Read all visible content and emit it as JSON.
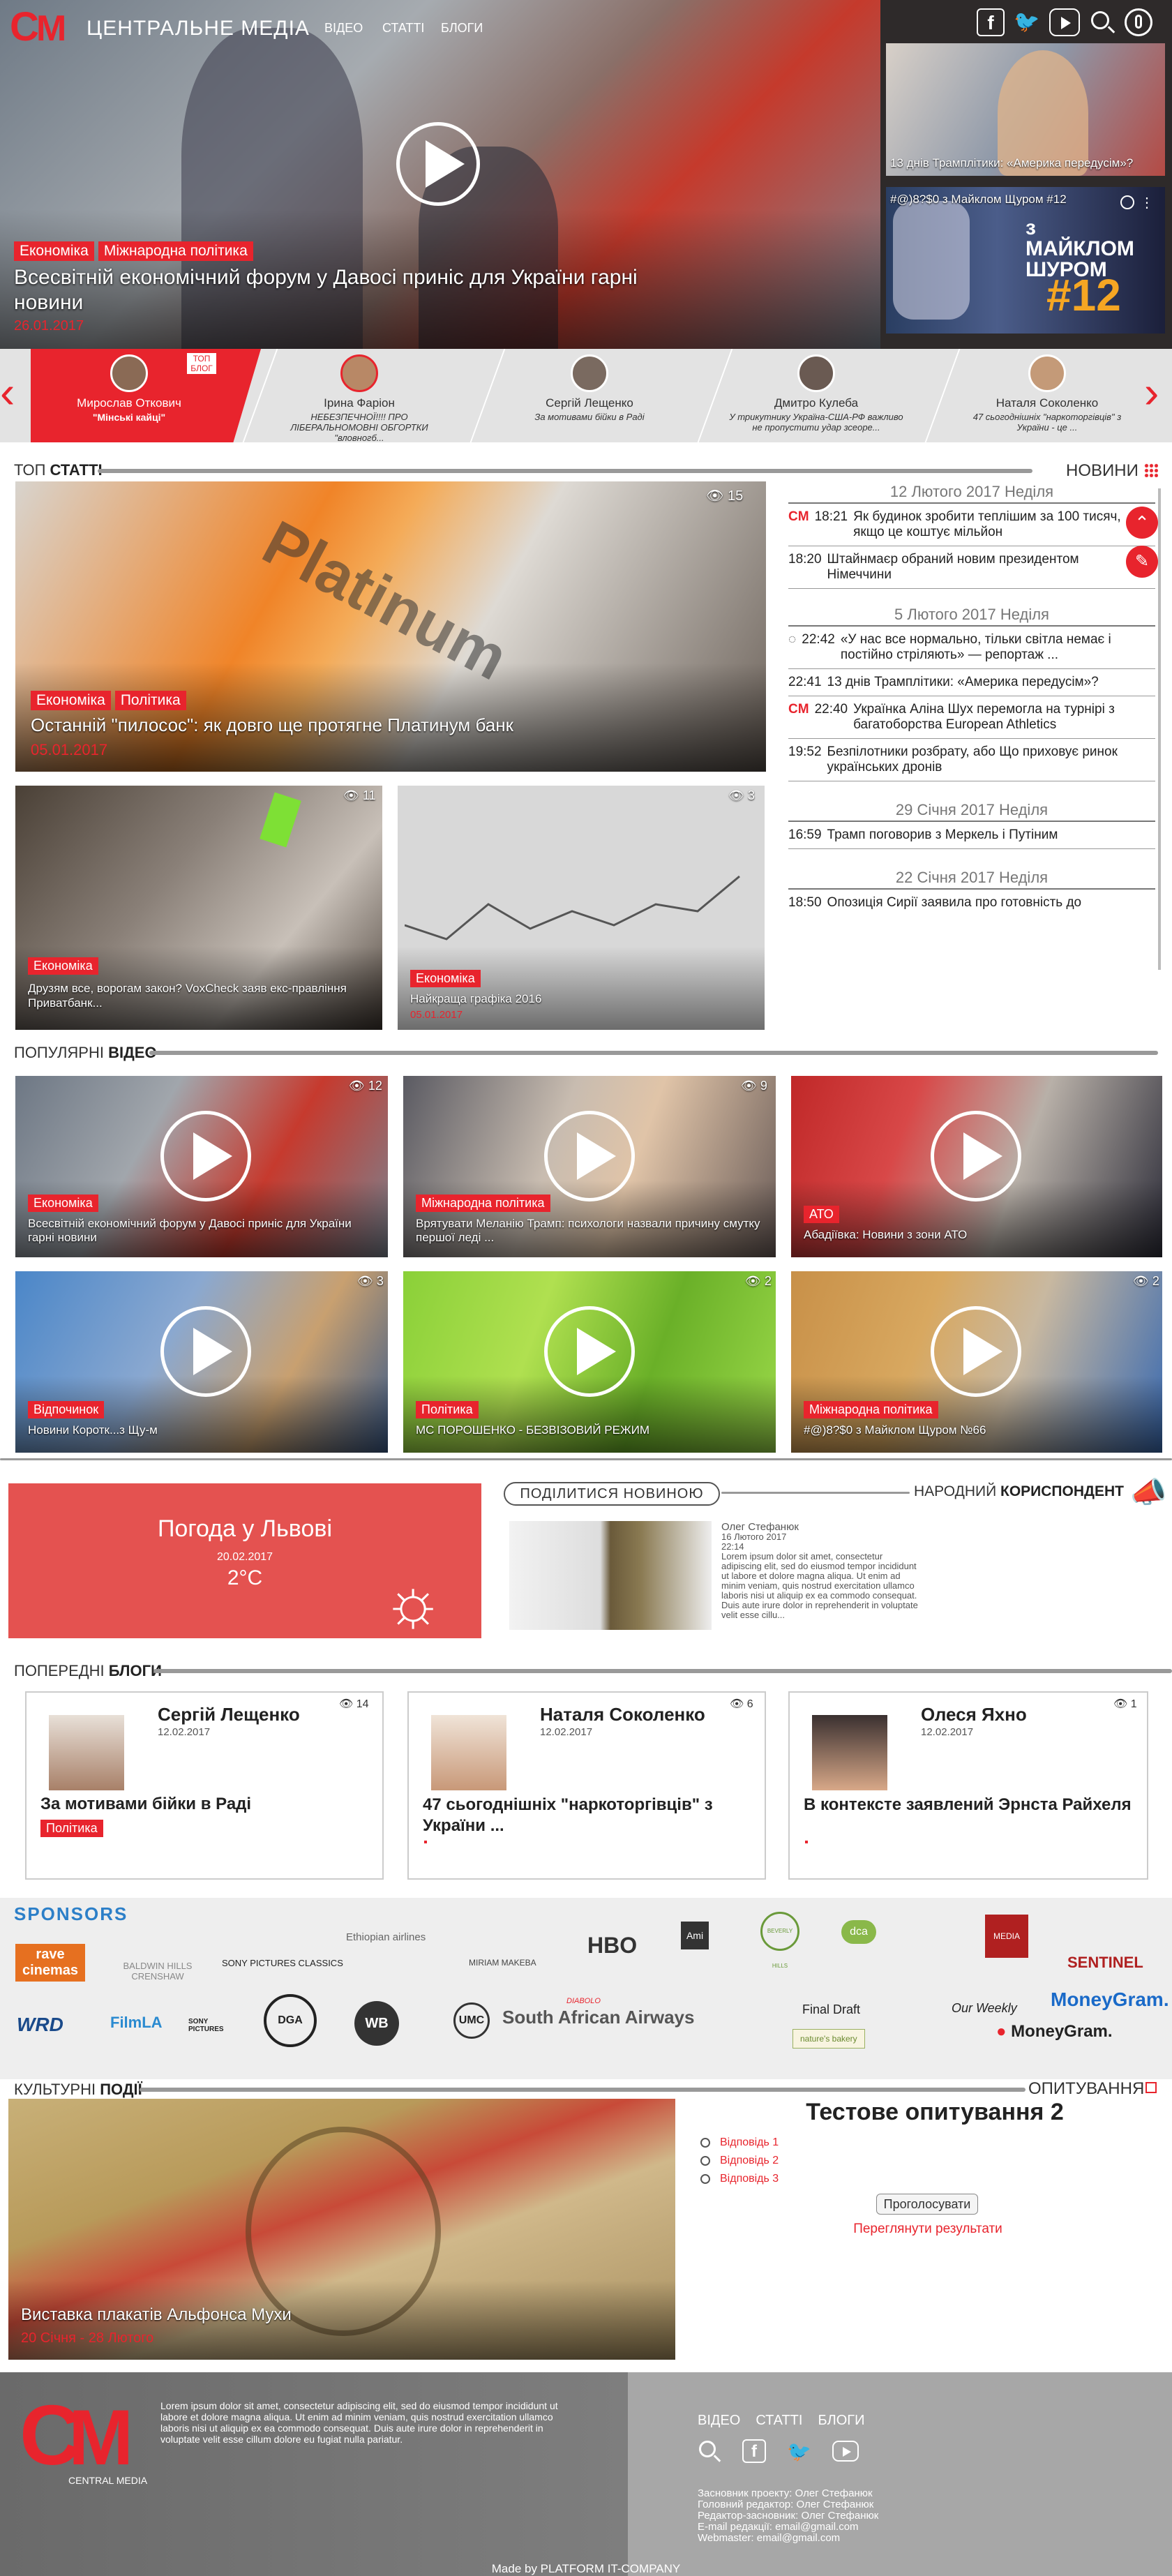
{
  "header": {
    "logo": "CM",
    "title": "ЦЕНТРАЛЬНЕ МЕДІА",
    "nav": [
      "ВІДЕО",
      "СТАТТІ",
      "БЛОГИ"
    ]
  },
  "hero": {
    "tags": [
      "Економіка",
      "Міжнародна політика"
    ],
    "title": "Всесвітній економічний форум у Давосі приніс для України гарні новини",
    "date": "26.01.2017"
  },
  "side_videos": [
    {
      "caption": "13 днів Трамплітики: «Америка передусім»?"
    },
    {
      "caption": "#@)8?$0 з Майклом Щуром #12",
      "overlay": "з МАЙКЛОМ ШУРОМ",
      "num": "#12"
    }
  ],
  "bloggers": [
    {
      "name": "Мирослав Откович",
      "title": "\"Мінські кайці\"",
      "badge": "ТОП БЛОГ"
    },
    {
      "name": "Ірина Фаріон",
      "title": "НЕБЕЗПЕЧНОЇ!!!! ПРО ЛІБЕРАЛЬНОМОВНІ ОБГОРТКИ \"вловногб..."
    },
    {
      "name": "Сергій Лещенко",
      "title": "За мотивами бійки в Раді"
    },
    {
      "name": "Дмитро Кулеба",
      "title": "У трикутнику Україна-США-РФ важливо не пропустити удар зсеоре..."
    },
    {
      "name": "Наталя Соколенко",
      "title": "47 сьогоднішніх \"наркоторгівців\" з України - це ..."
    }
  ],
  "top": {
    "head_pre": "ТОП",
    "head_bold": "СТАТТІ",
    "main": {
      "tags": [
        "Економіка",
        "Політика"
      ],
      "title": "Останній \"пилосос\": як довго ще протягне Платинум банк",
      "date": "05.01.2017",
      "views": "15"
    },
    "a2": {
      "tag": "Економіка",
      "title": "Друзям все, ворогам закон? VoxCheck заяв екс-правління Приватбанк...",
      "views": "11"
    },
    "a3": {
      "tag": "Економіка",
      "title": "Найкраща графіка 2016",
      "date": "05.01.2017",
      "views": "3"
    }
  },
  "news": {
    "head": "НОВИНИ",
    "groups": [
      {
        "date": "12 Лютого 2017 Неділя",
        "items": [
          {
            "time": "18:21",
            "text": "Як будинок зробити теплішим за 100 тисяч, якщо це коштує мільйон",
            "icon": "cm"
          },
          {
            "time": "18:20",
            "text": "Штайнмаєр обраний новим президентом Німеччини"
          }
        ]
      },
      {
        "date": "5 Лютого 2017 Неділя",
        "items": [
          {
            "time": "22:42",
            "text": "«У нас все нормально, тільки світла немає і постійно стріляють» — репортаж ...",
            "icon": "load"
          },
          {
            "time": "22:41",
            "text": "13 днів Трамплітики: «Америка передусім»?"
          },
          {
            "time": "22:40",
            "text": "Українка Аліна Шух перемогла на турнірі з багатоборства European Athletics",
            "icon": "cm"
          },
          {
            "time": "19:52",
            "text": "Безпілотники розбрату, або Що приховує ринок українських дронів"
          }
        ]
      },
      {
        "date": "29 Січня 2017 Неділя",
        "items": [
          {
            "time": "16:59",
            "text": "Трамп поговорив з Меркель і Путіним"
          }
        ]
      },
      {
        "date": "22 Січня 2017 Неділя",
        "items": [
          {
            "time": "18:50",
            "text": "Опозиція Сирії заявила про готовність до"
          }
        ]
      }
    ]
  },
  "popular": {
    "head_pre": "ПОПУЛЯРНІ",
    "head_bold": "ВІДЕО",
    "items": [
      {
        "tag": "Економіка",
        "title": "Всесвітній економічний форум у Давосі приніс для України гарні новини",
        "views": "12"
      },
      {
        "tag": "Міжнародна політика",
        "title": "Врятувати Меланію Трамп: психологи назвали причину смутку першої леді ...",
        "views": "9"
      },
      {
        "tag": "АТО",
        "title": "Абадіївка: Новини з зони АТО",
        "views": ""
      },
      {
        "tag": "Відпочинок",
        "title": "Новини Коротк...з Щу-м",
        "views": "3"
      },
      {
        "tag": "Політика",
        "title": "МС ПОРОШЕНКО - БЕЗВІЗОВИЙ РЕЖИМ",
        "views": "2"
      },
      {
        "tag": "Міжнародна політика",
        "title": "#@)8?$0 з Майклом Щуром №66",
        "views": "2"
      }
    ]
  },
  "weather": {
    "title": "Погода у Львові",
    "date": "20.02.2017",
    "temp": "2°C"
  },
  "share": {
    "button": "ПОДІЛИТИСЯ НОВИНОЮ",
    "head_pre": "НАРОДНИЙ",
    "head_bold": "КОРИСПОНДЕНТ",
    "author": "Олег Стефанюк",
    "date": "16 Лютого 2017",
    "time": "22:14",
    "text": "Lorem ipsum dolor sit amet, consectetur adipiscing elit, sed do eiusmod tempor incididunt ut labore et dolore magna aliqua. Ut enim ad minim veniam, quis nostrud exercitation ullamco laboris nisi ut aliquip ex ea commodo consequat. Duis aute irure dolor in reprehenderit in voluptate velit esse cillu..."
  },
  "prev_blogs": {
    "head_pre": "ПОПЕРЕДНІ",
    "head_bold": "БЛОГИ",
    "items": [
      {
        "name": "Сергій Лещенко",
        "date": "12.02.2017",
        "title": "За мотивами бійки в Раді",
        "tag": "Політика",
        "views": "14"
      },
      {
        "name": "Наталя Соколенко",
        "date": "12.02.2017",
        "title": "47 сьогоднішніх \"наркоторгівців\" з України ...",
        "tag": "",
        "views": "6"
      },
      {
        "name": "Олеся Яхно",
        "date": "12.02.2017",
        "title": "В контексте заявлений Эрнста Райхеля",
        "tag": "",
        "views": "1"
      }
    ]
  },
  "sponsors": {
    "title": "SPONSORS",
    "logos": [
      "rave cinemas",
      "BALDWIN HILLS CRENSHAW",
      "SONY PICTURES CLASSICS",
      "Ethiopian airlines",
      "MIRIAM MAKEBA",
      "HBO",
      "Ami",
      "BEVERLY HILLS",
      "dca",
      "MEDIA",
      "SENTINEL",
      "WRD",
      "FilmLA",
      "SONY PICTURES",
      "DGA",
      "WB",
      "UMC",
      "South African Airways",
      "DIABOLO",
      "Final Draft",
      "Our Weekly",
      "MoneyGram.",
      "nature's bakery"
    ]
  },
  "culture": {
    "head_pre": "КУЛЬТУРНІ",
    "head_bold": "ПОДІЇ",
    "title": "Виставка плакатів Альфонса Мухи",
    "dates": "20 Січня - 28 Лютого"
  },
  "poll": {
    "head": "ОПИТУВАННЯ",
    "title": "Тестове опитування 2",
    "options": [
      "Відповідь 1",
      "Відповідь 2",
      "Відповідь 3"
    ],
    "vote": "Проголосувати",
    "results": "Переглянути результати"
  },
  "footer": {
    "logo_sub": "CENTRAL MEDIA",
    "lorem": "Lorem ipsum dolor sit amet, consectetur adipiscing elit, sed do eiusmod tempor incididunt ut labore et dolore magna aliqua. Ut enim ad minim veniam, quis nostrud exercitation ullamco laboris nisi ut aliquip ex ea commodo consequat. Duis aute irure dolor in reprehenderit in voluptate velit esse cillum dolore eu fugiat nulla pariatur.",
    "nav": [
      "ВІДЕО",
      "СТАТТІ",
      "БЛОГИ"
    ],
    "credits": [
      "Засновник проекту: Олег Стефанюк",
      "Головний редактор: Олег Стефанюк",
      "Редактор-засновник: Олег Стефанюк",
      "E-mail редакції: email@gmail.com",
      "Webmaster: email@gmail.com"
    ],
    "made": "Made by PLATFORM IT-COMPANY"
  }
}
